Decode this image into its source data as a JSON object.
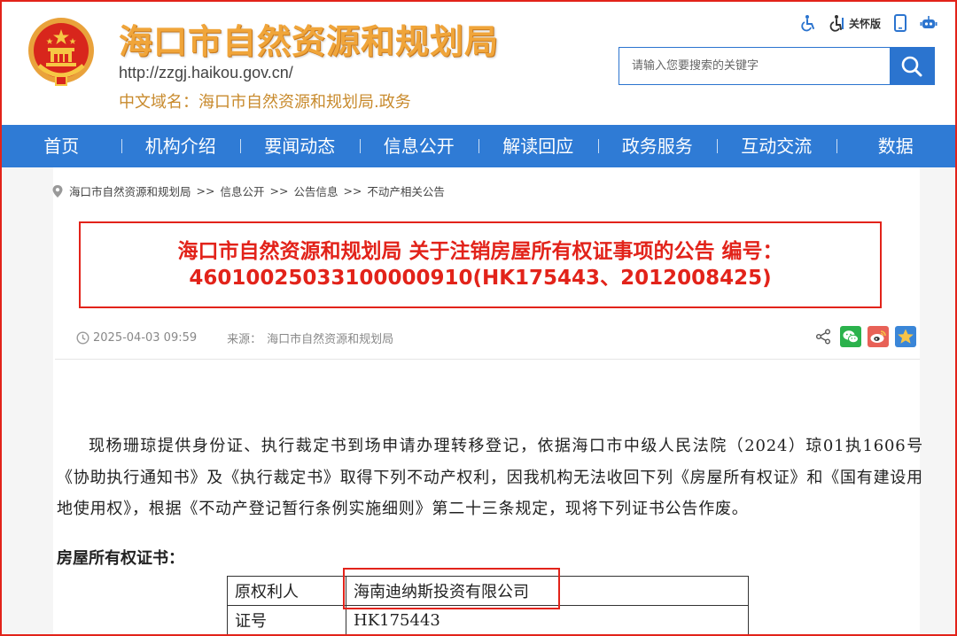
{
  "site": {
    "title": "海口市自然资源和规划局",
    "url": "http://zzgj.haikou.gov.cn/",
    "cn_domain_label": "中文域名：",
    "cn_domain_value": "海口市自然资源和规划局.政务"
  },
  "toolbar": {
    "care_mode_label": "关怀版"
  },
  "search": {
    "placeholder": "请输入您要搜索的关键字"
  },
  "nav": {
    "items": [
      "首页",
      "机构介绍",
      "要闻动态",
      "信息公开",
      "解读回应",
      "政务服务",
      "互动交流",
      "数据"
    ]
  },
  "breadcrumb": {
    "items": [
      "海口市自然资源和规划局",
      "信息公开",
      "公告信息",
      "不动产相关公告"
    ],
    "separator": ">>"
  },
  "article": {
    "title_line1": "海口市自然资源和规划局 关于注销房屋所有权证事项的公告  编号：",
    "title_line2": "46010025033100000910(HK175443、2012008425)",
    "date": "2025-04-03 09:59",
    "source_label": "来源：",
    "source_value": "海口市自然资源和规划局",
    "body": "现杨珊琼提供身份证、执行裁定书到场申请办理转移登记，依据海口市中级人民法院（2024）琼01执1606号《协助执行通知书》及《执行裁定书》取得下列不动产权利，因我机构无法收回下列《房屋所有权证》和《国有建设用地使用权》，根据《不动产登记暂行条例实施细则》第二十三条规定，现将下列证书公告作废。",
    "section_title": "房屋所有权证书：",
    "table": [
      {
        "key": "原权利人",
        "value": "海南迪纳斯投资有限公司"
      },
      {
        "key": "证号",
        "value": "HK175443"
      }
    ]
  },
  "colors": {
    "nav_blue": "#2f7bd5",
    "title_orange": "#f0a53a",
    "highlight_red": "#e2231a"
  }
}
